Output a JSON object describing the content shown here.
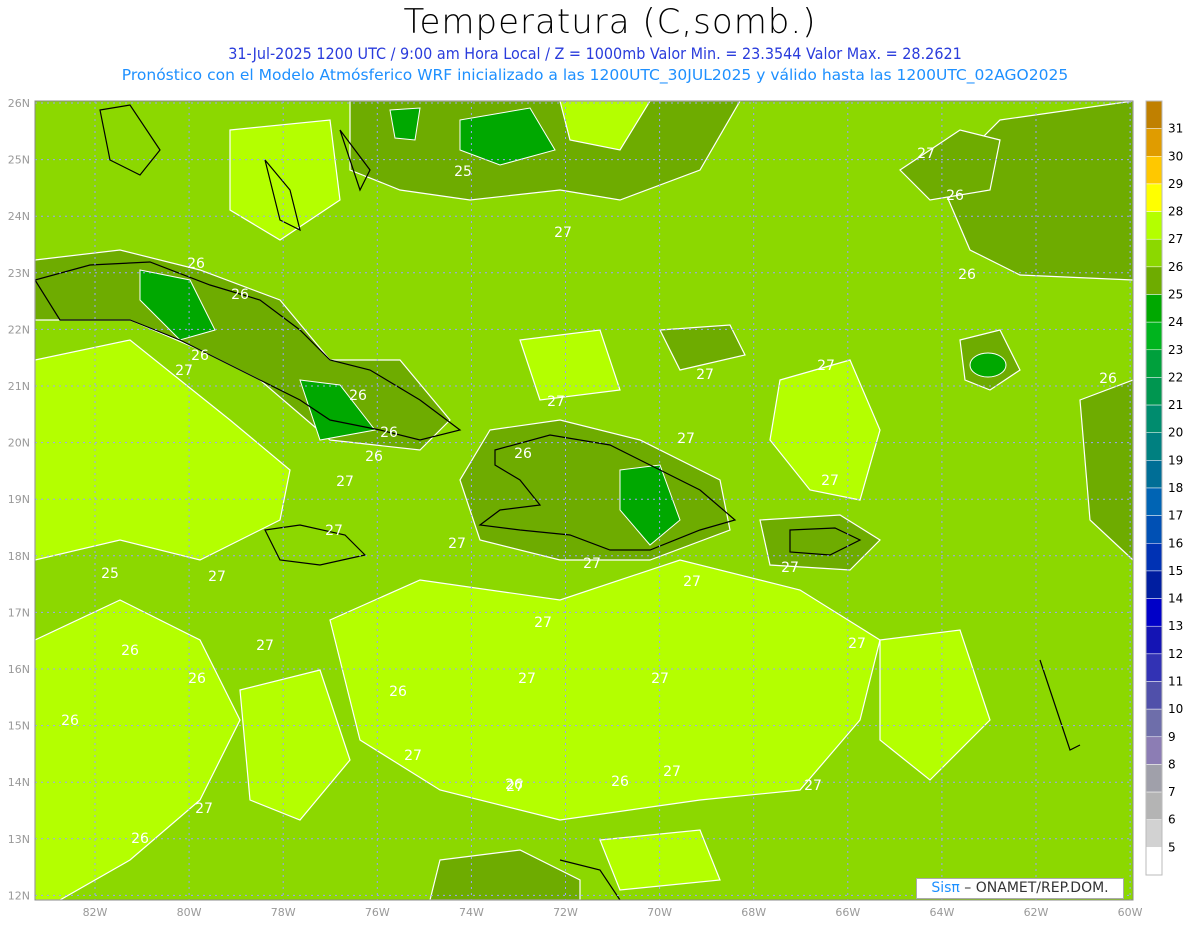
{
  "title": "Temperatura (C,somb.)",
  "subtitle1": "31-Jul-2025  1200 UTC / 9:00 am Hora Local / Z = 1000mb   Valor Min. = 23.3544   Valor Max. = 28.2621",
  "subtitle2": "Pronóstico con el Modelo Atmósferico WRF inicializado a las 1200UTC_30JUL2025 y válido hasta las  1200UTC_02AGO2025",
  "credit": {
    "brand": "Sisπ",
    "text": " – ONAMET/REP.DOM."
  },
  "lat_labels": [
    "26N",
    "25N",
    "24N",
    "23N",
    "22N",
    "21N",
    "20N",
    "19N",
    "18N",
    "17N",
    "16N",
    "15N",
    "14N",
    "13N",
    "12N"
  ],
  "lon_labels": [
    "82W",
    "80W",
    "78W",
    "76W",
    "74W",
    "72W",
    "70W",
    "68W",
    "66W",
    "64W",
    "62W",
    "60W"
  ],
  "colorbar": {
    "labels": [
      "31",
      "30",
      "29",
      "28",
      "27",
      "26",
      "25",
      "24",
      "23",
      "22",
      "21",
      "20",
      "19",
      "18",
      "17",
      "16",
      "15",
      "14",
      "13",
      "12",
      "11",
      "10",
      "9",
      "8",
      "7",
      "6",
      "5"
    ],
    "colors": [
      "#c08000",
      "#e09c00",
      "#ffc800",
      "#ffff00",
      "#b4ff00",
      "#8cd800",
      "#6eac00",
      "#00a800",
      "#00b41e",
      "#00a03c",
      "#009650",
      "#008c6e",
      "#008080",
      "#006e96",
      "#0064b4",
      "#0050b4",
      "#0032b4",
      "#001ea0",
      "#0000c8",
      "#1414b4",
      "#3232b4",
      "#5050aa",
      "#6e6eaa",
      "#8c7db4",
      "#a0a0aa",
      "#b4b4b4",
      "#d2d2d2",
      "#ffffff"
    ]
  },
  "contour_labels": [
    "25",
    "26",
    "26",
    "26",
    "27",
    "26",
    "27",
    "27",
    "26",
    "26",
    "27",
    "26",
    "25",
    "26",
    "27",
    "26",
    "26",
    "26",
    "27",
    "26",
    "27",
    "27",
    "27",
    "27",
    "27",
    "26",
    "27",
    "27",
    "27",
    "27",
    "27",
    "27",
    "27",
    "27",
    "27",
    "27",
    "27",
    "27",
    "27",
    "27",
    "26",
    "26",
    "26",
    "26"
  ]
}
